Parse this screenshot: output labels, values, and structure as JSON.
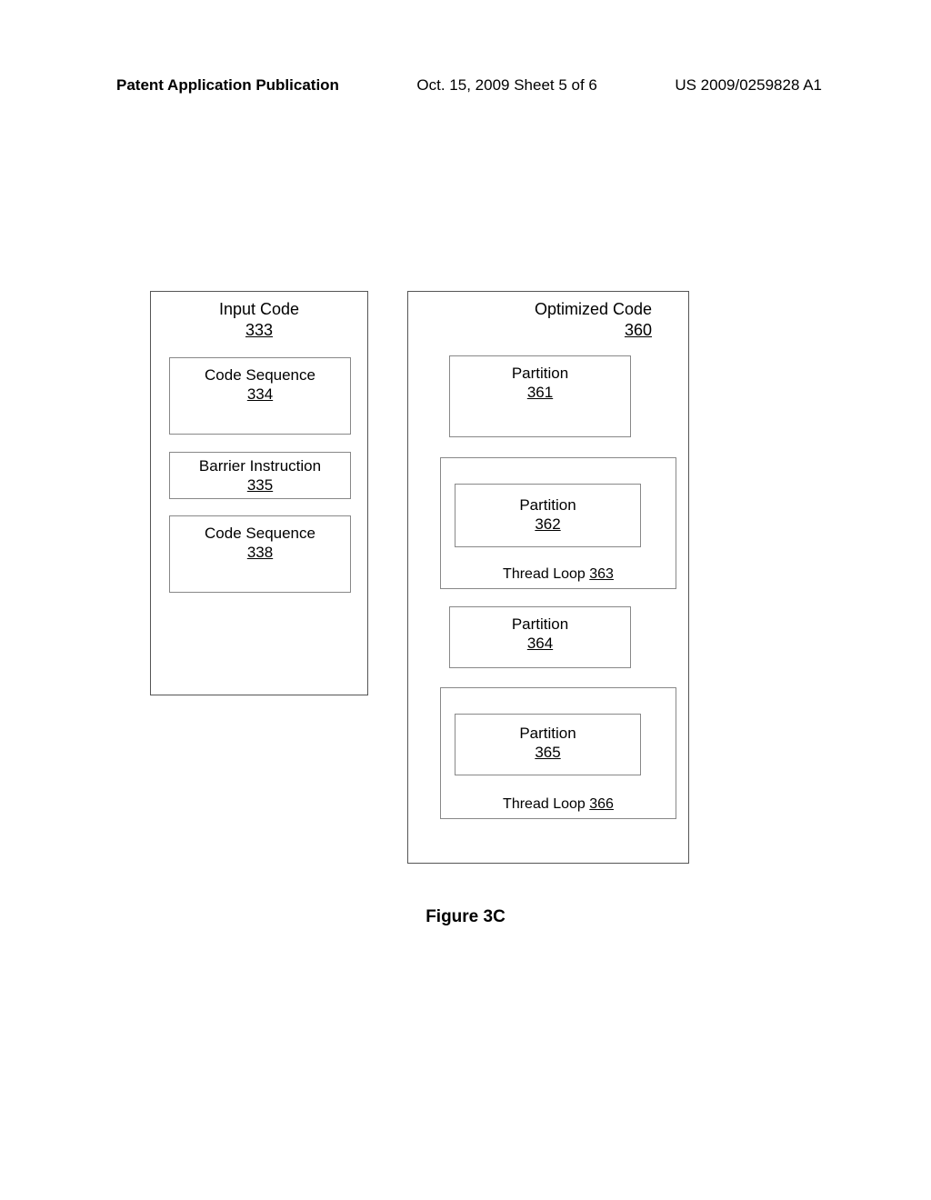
{
  "header": {
    "left": "Patent Application Publication",
    "center": "Oct. 15, 2009  Sheet 5 of 6",
    "right": "US 2009/0259828 A1"
  },
  "input_code": {
    "title": "Input Code",
    "ref": "333",
    "code_seq1": {
      "label": "Code Sequence",
      "ref": "334"
    },
    "barrier": {
      "label": "Barrier Instruction",
      "ref": "335"
    },
    "code_seq2": {
      "label": "Code Sequence",
      "ref": "338"
    }
  },
  "optimized_code": {
    "title": "Optimized Code",
    "ref": "360",
    "part361": {
      "label": "Partition",
      "ref": "361"
    },
    "part362": {
      "label": "Partition",
      "ref": "362"
    },
    "loop363": {
      "label": "Thread Loop",
      "ref": "363"
    },
    "part364": {
      "label": "Partition",
      "ref": "364"
    },
    "part365": {
      "label": "Partition",
      "ref": "365"
    },
    "loop366": {
      "label": "Thread Loop",
      "ref": "366"
    }
  },
  "figure_caption": "Figure 3C"
}
